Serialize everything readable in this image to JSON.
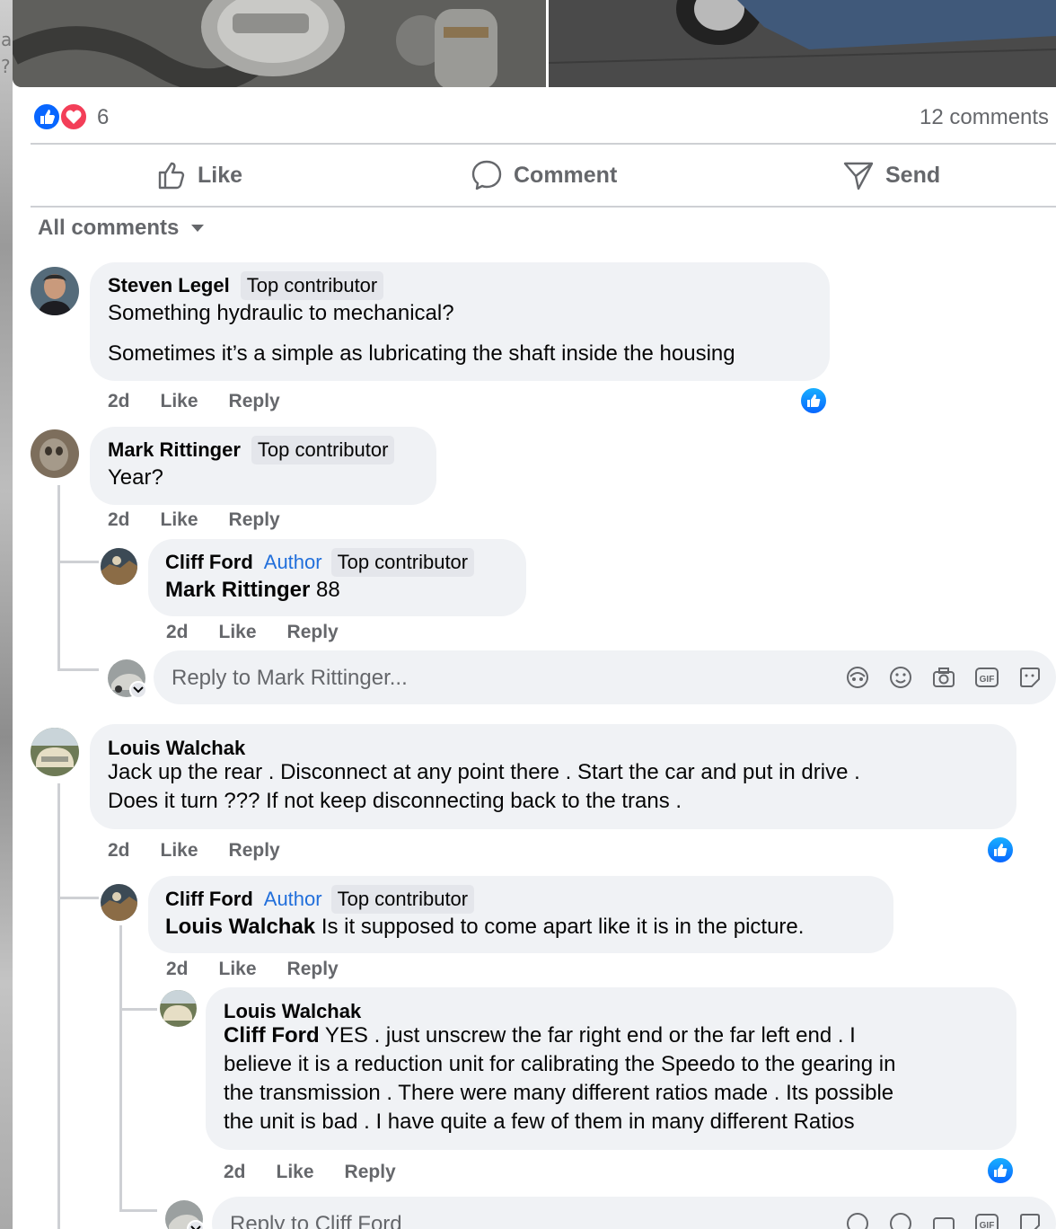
{
  "post": {
    "reaction_count": "6",
    "comments_count": "12 comments"
  },
  "actions": {
    "like": "Like",
    "comment": "Comment",
    "send": "Send"
  },
  "filter": {
    "label": "All comments"
  },
  "comments": [
    {
      "author": "Steven Legel",
      "badge": "Top contributor",
      "text1": "Something hydraulic to mechanical?",
      "text2": "Sometimes it’s a simple as lubricating the shaft inside the housing",
      "time": "2d",
      "like": "Like",
      "reply": "Reply"
    },
    {
      "author": "Mark Rittinger",
      "badge": "Top contributor",
      "text": "Year?",
      "time": "2d",
      "like": "Like",
      "reply": "Reply"
    },
    {
      "author": "Cliff Ford",
      "author_badge": "Author",
      "badge": "Top contributor",
      "mention": "Mark Rittinger",
      "text": " 88",
      "time": "2d",
      "like": "Like",
      "reply": "Reply"
    },
    {
      "author": "Louis Walchak",
      "text1": "Jack up the rear . Disconnect at any point there . Start the car and put in drive .",
      "text2": "Does it turn ??? If not keep disconnecting back to the trans .",
      "time": "2d",
      "like": "Like",
      "reply": "Reply"
    },
    {
      "author": "Cliff Ford",
      "author_badge": "Author",
      "badge": "Top contributor",
      "mention": "Louis Walchak",
      "text": " Is it supposed to come apart like it is in the picture.",
      "time": "2d",
      "like": "Like",
      "reply": "Reply"
    },
    {
      "author": "Louis Walchak",
      "mention": "Cliff Ford",
      "line1": " YES . just unscrew the far right end or the far left end . I",
      "line2": "believe it is a reduction unit for calibrating the Speedo to the gearing in",
      "line3": "the transmission . There were many different ratios made . Its possible",
      "line4": "the unit is bad . I have quite a few of them in many different Ratios",
      "time": "2d",
      "like": "Like",
      "reply": "Reply"
    }
  ],
  "reply_boxes": {
    "mark": "Reply to Mark Rittinger...",
    "cliff": "Reply to Cliff Ford"
  },
  "colors": {
    "like_blue": "#0866ff",
    "author_blue": "#216fdb",
    "bubble_bg": "#f0f2f5",
    "secondary_text": "#65676b"
  },
  "icons": [
    "like-icon",
    "love-icon",
    "thumb-up-outline-icon",
    "comment-bubble-icon",
    "send-icon",
    "dropdown-caret-icon",
    "avatar-emoji-icon",
    "emoji-icon",
    "camera-icon",
    "gif-icon",
    "sticker-icon"
  ]
}
